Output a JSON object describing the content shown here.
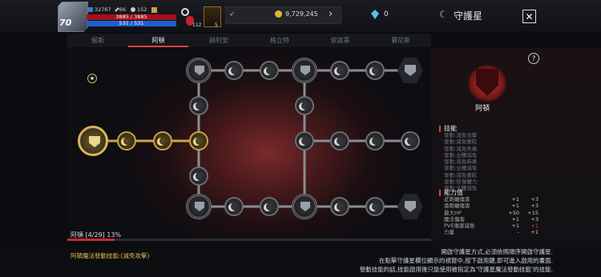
{
  "player": {
    "level": "70",
    "stat1": "32767",
    "stat2": "66",
    "stat3": "152",
    "hp": "3885 / 3885",
    "mp": "531 / 531",
    "potion_count": "112",
    "skill_count": "5"
  },
  "currency": {
    "gold": "9,729,245",
    "crystals": "0"
  },
  "header": {
    "title": "守護星",
    "close": "✕"
  },
  "tabs": [
    "留斯",
    "阿頓",
    "赫利安",
    "格立特",
    "依諾蒂",
    "賽尼斯"
  ],
  "active_tab": 1,
  "progress": {
    "label": "阿頓 [4/29] 13%",
    "percent": 13
  },
  "side": {
    "help": "?",
    "constellation_name": "阿頓",
    "skills_heading": "技能",
    "skills": [
      "發動:減免攻擊",
      "發動:減免暈眩",
      "發動:減免焦痛",
      "發動:全體減免",
      "發動:減免麻痺",
      "發動:全體減免",
      "發動:減免暈眩",
      "發動:恢復體力",
      "發動:全體減免"
    ],
    "stats_heading": "能力值",
    "stats": [
      {
        "name": "近距離傷害",
        "cur": "+1",
        "next": "+3"
      },
      {
        "name": "遠距離傷害",
        "cur": "+1",
        "next": "+3"
      },
      {
        "name": "最大HP",
        "cur": "+50",
        "next": "+15"
      },
      {
        "name": "魔法傷害",
        "cur": "+1",
        "next": "+3"
      },
      {
        "name": "PVE傷害減免",
        "cur": "+1",
        "next": "+1"
      },
      {
        "name": "力量",
        "cur": "-",
        "next": "+1"
      }
    ]
  },
  "bottom": {
    "left": "阿頓魔法發動技能:(減免攻擊)",
    "right_lines": [
      "開啟守護星方式,必須依照順序開啟守護星.",
      "在點擊守護星欄位顯示的視窗中,按下啟用鍵,即可進入啟用的畫面.",
      "發動技能的話,技能啟用後只能使用被指定為'守護星魔法發動技能'的技能."
    ]
  },
  "colors": {
    "accent": "#d9453f",
    "gold": "#e0b848",
    "hp": "#a3101a",
    "mp": "#1d5fcf"
  }
}
